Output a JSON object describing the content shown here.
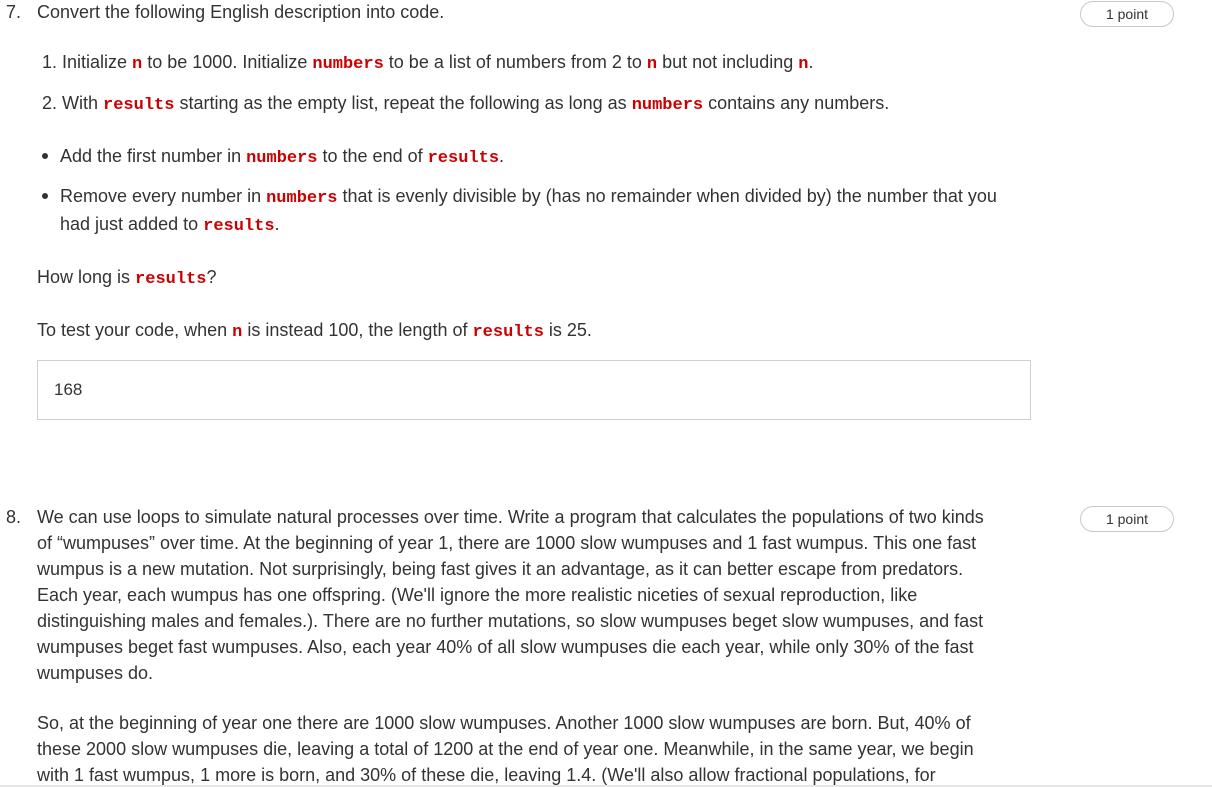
{
  "question7": {
    "number": "7.",
    "title": "Convert the following English description into code.",
    "points": "1 point",
    "step1": {
      "t1": "1. Initialize ",
      "c1": "n",
      "t2": " to be 1000.  Initialize ",
      "c2": "numbers",
      "t3": " to be a list of numbers from 2 to ",
      "c3": "n",
      "t4": "  but not including ",
      "c4": "n",
      "t5": "."
    },
    "step2": {
      "t1": "2. With ",
      "c1": "results",
      "t2": " starting as the empty list, repeat the following as long as ",
      "c2": "numbers",
      "t3": " contains any numbers."
    },
    "bullet1": {
      "t1": "Add the first number in ",
      "c1": "numbers",
      "t2": " to the end of ",
      "c2": "results",
      "t3": "."
    },
    "bullet2": {
      "t1": "Remove every number in ",
      "c1": "numbers",
      "t2": " that is evenly divisible by (has no remainder when divided by) the number that you",
      "t3": "had just added to ",
      "c2": "results",
      "t4": "."
    },
    "question_text": {
      "t1": "How long is ",
      "c1": "results",
      "t2": "?"
    },
    "test_text": {
      "t1": "To test your code, when ",
      "c1": "n",
      "t2": " is instead 100, the length of ",
      "c2": "results",
      "t3": " is 25."
    },
    "answer_value": "168"
  },
  "question8": {
    "number": "8.",
    "points": "1 point",
    "para1_lines": [
      "We can use loops to simulate natural processes over time.  Write a program that calculates the populations of two kinds",
      "of “wumpuses” over time.  At the beginning of year 1, there are 1000 slow wumpuses and 1 fast wumpus.  This one fast",
      "wumpus is a new mutation.  Not surprisingly, being fast gives it an advantage, as it can better escape from predators.",
      "Each year, each wumpus has one offspring.  (We'll ignore the more realistic niceties of sexual reproduction, like",
      "distinguishing males and females.).  There are no further mutations, so slow wumpuses beget slow wumpuses, and fast",
      "wumpuses beget fast wumpuses.  Also, each year 40% of all slow wumpuses die each year, while only 30% of the fast",
      "wumpuses do."
    ],
    "para2_lines": [
      "So, at the beginning of year one there are 1000 slow wumpuses.  Another 1000 slow wumpuses are born.  But, 40% of",
      "these 2000 slow wumpuses die, leaving a total of 1200 at the end of year one.  Meanwhile, in the same year, we begin",
      "with 1 fast wumpus, 1 more is born, and 30% of these die, leaving 1.4.  (We'll also allow fractional populations, for"
    ]
  }
}
